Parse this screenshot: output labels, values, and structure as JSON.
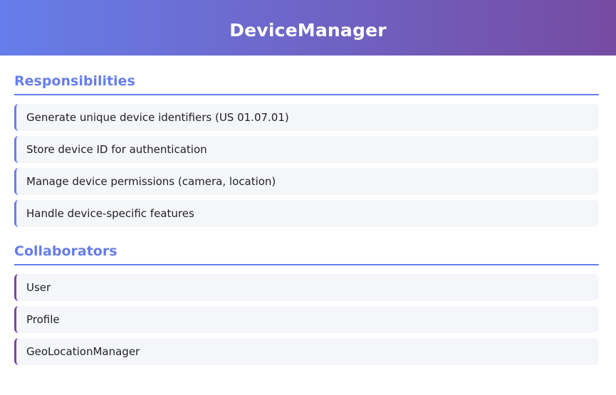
{
  "header": {
    "title": "DeviceManager"
  },
  "responsibilities": {
    "title": "Responsibilities",
    "items": [
      "Generate unique device identifiers (US 01.07.01)",
      "Store device ID for authentication",
      "Manage device permissions (camera, location)",
      "Handle device-specific features"
    ]
  },
  "collaborators": {
    "title": "Collaborators",
    "items": [
      "User",
      "Profile",
      "GeoLocationManager"
    ]
  },
  "colors": {
    "header_gradient_start": "#667eea",
    "header_gradient_end": "#764ba2",
    "section_title": "#667eea",
    "item_background": "#f5f6fa"
  }
}
